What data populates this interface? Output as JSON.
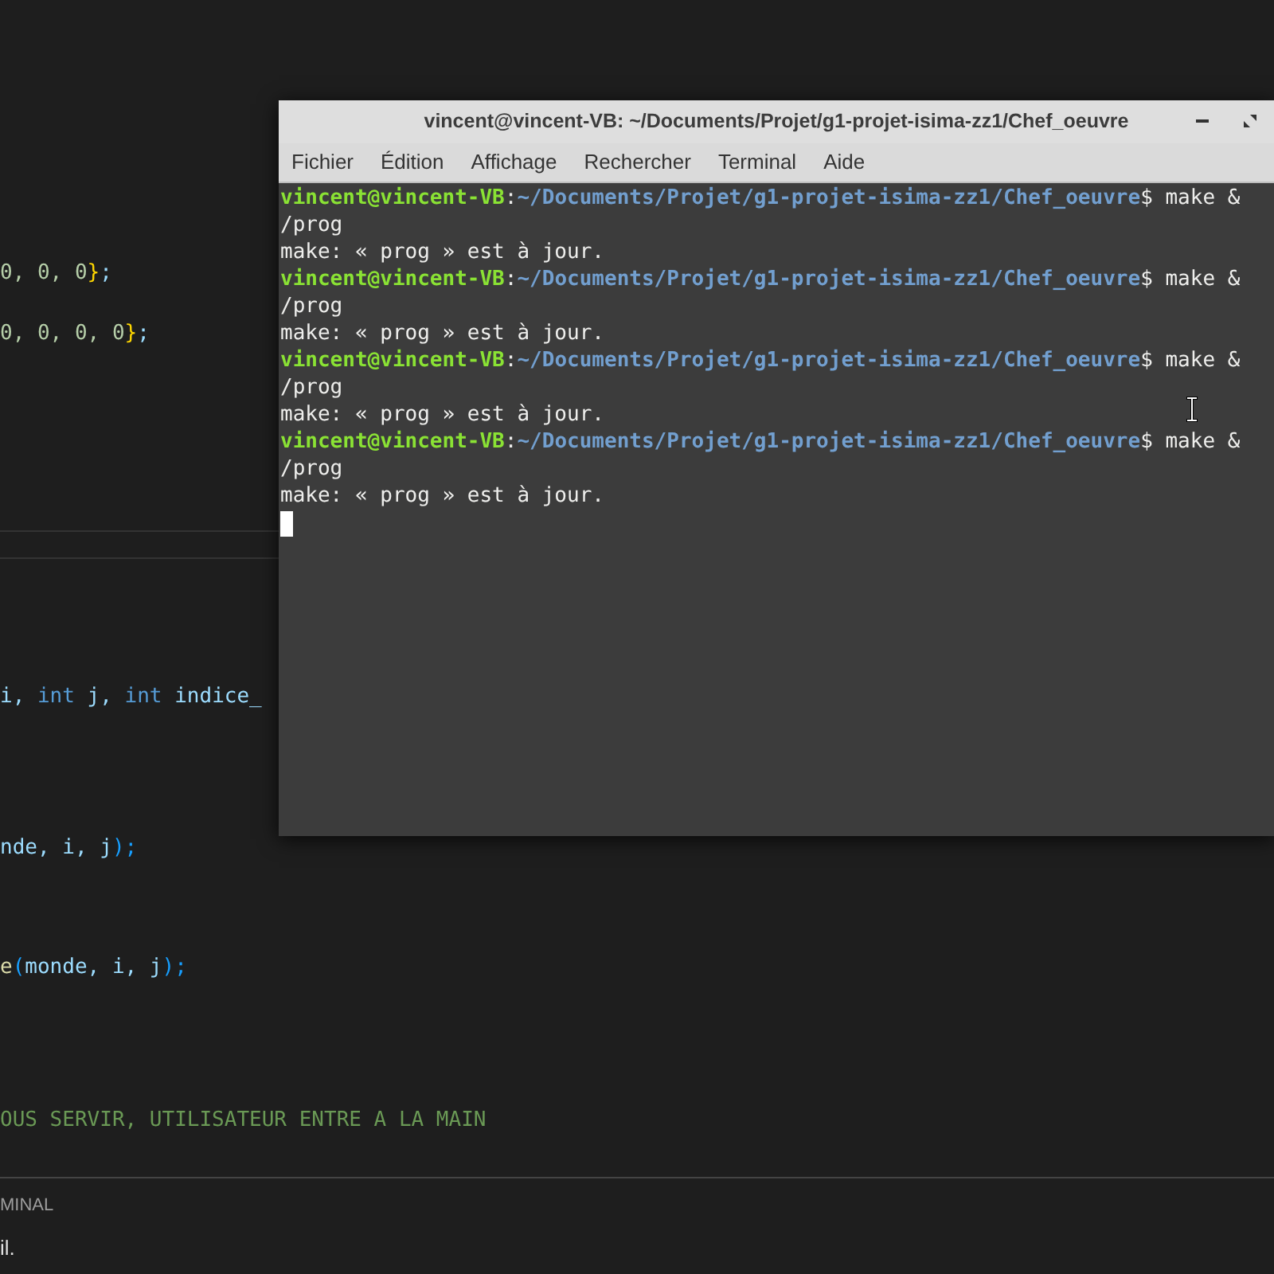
{
  "editor": {
    "lines": [
      {
        "segments": [
          {
            "text": "0, 0, 0",
            "kind": "number"
          },
          {
            "text": "}",
            "kind": "brace"
          },
          {
            "text": ";",
            "kind": "plain"
          }
        ]
      },
      {
        "segments": [
          {
            "text": "0, 0, 0, 0",
            "kind": "number"
          },
          {
            "text": "}",
            "kind": "brace"
          },
          {
            "text": ";",
            "kind": "plain"
          }
        ]
      },
      {
        "segments": [
          {
            "text": "i, ",
            "kind": "plain"
          },
          {
            "text": "int",
            "kind": "keyword"
          },
          {
            "text": " j, ",
            "kind": "plain"
          },
          {
            "text": "int",
            "kind": "keyword"
          },
          {
            "text": " indice_",
            "kind": "plain"
          }
        ]
      },
      {
        "segments": [
          {
            "text": "nde, i, j",
            "kind": "plain"
          },
          {
            "text": ");",
            "kind": "paren"
          }
        ]
      },
      {
        "segments": [
          {
            "text": "e",
            "kind": "function"
          },
          {
            "text": "(",
            "kind": "paren"
          },
          {
            "text": "monde, i, j",
            "kind": "plain"
          },
          {
            "text": ");",
            "kind": "paren"
          }
        ]
      },
      {
        "segments": [
          {
            "text": "OUS SERVIR, UTILISATEUR ENTRE A LA MAIN",
            "kind": "comment"
          }
        ]
      }
    ]
  },
  "panel": {
    "tab": "MINAL",
    "text": "il."
  },
  "terminal": {
    "title": "vincent@vincent-VB: ~/Documents/Projet/g1-projet-isima-zz1/Chef_oeuvre",
    "menu": [
      "Fichier",
      "Édition",
      "Affichage",
      "Rechercher",
      "Terminal",
      "Aide"
    ],
    "lines": [
      {
        "kind": "prompt",
        "user": "vincent@vincent-VB",
        "separator": ":",
        "path": "~/Documents/Projet/g1-projet-isima-zz1/Chef_oeuvre",
        "command": "$ make &"
      },
      {
        "kind": "output",
        "text": "/prog"
      },
      {
        "kind": "output",
        "text": "make: « prog » est à jour."
      },
      {
        "kind": "prompt",
        "user": "vincent@vincent-VB",
        "separator": ":",
        "path": "~/Documents/Projet/g1-projet-isima-zz1/Chef_oeuvre",
        "command": "$ make &"
      },
      {
        "kind": "output",
        "text": "/prog"
      },
      {
        "kind": "output",
        "text": "make: « prog » est à jour."
      },
      {
        "kind": "prompt",
        "user": "vincent@vincent-VB",
        "separator": ":",
        "path": "~/Documents/Projet/g1-projet-isima-zz1/Chef_oeuvre",
        "command": "$ make &"
      },
      {
        "kind": "output",
        "text": "/prog"
      },
      {
        "kind": "output",
        "text": "make: « prog » est à jour."
      },
      {
        "kind": "prompt",
        "user": "vincent@vincent-VB",
        "separator": ":",
        "path": "~/Documents/Projet/g1-projet-isima-zz1/Chef_oeuvre",
        "command": "$ make &"
      },
      {
        "kind": "output",
        "text": "/prog"
      },
      {
        "kind": "output",
        "text": "make: « prog » est à jour."
      },
      {
        "kind": "cursor"
      }
    ]
  }
}
